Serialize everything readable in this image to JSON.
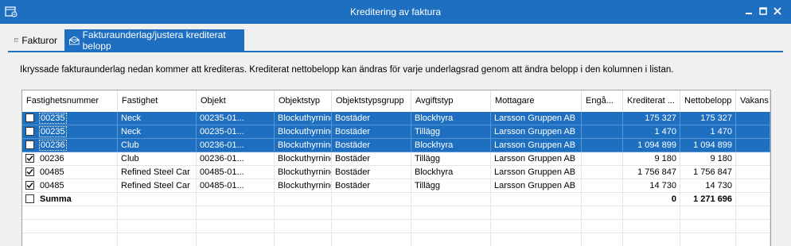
{
  "window": {
    "title": "Kreditering av faktura"
  },
  "tabs": [
    {
      "label": "Fakturor"
    },
    {
      "label": "Fakturaunderlag/justera krediterat belopp"
    }
  ],
  "instructions": "Ikryssade fakturaunderlag nedan kommer att krediteras. Krediterat nettobelopp kan ändras för varje underlagsrad genom att ändra belopp i den kolumnen i listan.",
  "table": {
    "columns": [
      "Fastighetsnummer",
      "Fastighet",
      "Objekt",
      "Objektstyp",
      "Objektstypsgrupp",
      "Avgiftstyp",
      "Mottagare",
      "Engå...",
      "Krediterat ...",
      "Nettobelopp",
      "Vakans"
    ],
    "rows": [
      {
        "checked": false,
        "selected": true,
        "cells": [
          "00235",
          "Neck",
          "00235-01...",
          "Blockuthyrning s...",
          "Bostäder",
          "Blockhyra",
          "Larsson Gruppen AB",
          "",
          "175 327",
          "175 327",
          ""
        ]
      },
      {
        "checked": false,
        "selected": true,
        "cells": [
          "00235",
          "Neck",
          "00235-01...",
          "Blockuthyrning s...",
          "Bostäder",
          "Tillägg",
          "Larsson Gruppen AB",
          "",
          "1 470",
          "1 470",
          ""
        ]
      },
      {
        "checked": false,
        "selected": true,
        "cells": [
          "00236",
          "Club",
          "00236-01...",
          "Blockuthyrning s...",
          "Bostäder",
          "Blockhyra",
          "Larsson Gruppen AB",
          "",
          "1 094 899",
          "1 094 899",
          ""
        ]
      },
      {
        "checked": true,
        "selected": false,
        "cells": [
          "00236",
          "Club",
          "00236-01...",
          "Blockuthyrning s...",
          "Bostäder",
          "Tillägg",
          "Larsson Gruppen AB",
          "",
          "9 180",
          "9 180",
          ""
        ]
      },
      {
        "checked": true,
        "selected": false,
        "cells": [
          "00485",
          "Refined Steel Car",
          "00485-01...",
          "Blockuthyrning s...",
          "Bostäder",
          "Blockhyra",
          "Larsson Gruppen AB",
          "",
          "1 756 847",
          "1 756 847",
          ""
        ]
      },
      {
        "checked": true,
        "selected": false,
        "cells": [
          "00485",
          "Refined Steel Car",
          "00485-01...",
          "Blockuthyrning s...",
          "Bostäder",
          "Tillägg",
          "Larsson Gruppen AB",
          "",
          "14 730",
          "14 730",
          ""
        ]
      }
    ],
    "summary": {
      "checked": false,
      "cells": [
        "Summa",
        "",
        "",
        "",
        "",
        "",
        "",
        "",
        "0",
        "1 271 696",
        ""
      ]
    },
    "empty_rows": 3
  },
  "colors": {
    "accent": "#1e6fbf",
    "selection": "#1e6fbf"
  }
}
